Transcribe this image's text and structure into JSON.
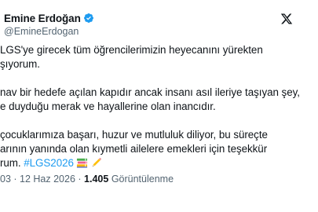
{
  "author": {
    "display_name": "Emine Erdoğan",
    "handle": "@EmineErdogan",
    "verified_color": "#1d9bf0"
  },
  "post": {
    "paragraphs": [
      [
        "LGS'ye girecek tüm öğrencilerimizin heyecanını yürekten",
        "şıyorum."
      ],
      [
        "nav bir hedefe açılan kapıdır ancak insanı asıl ileriye taşıyan şey,",
        "e duyduğu merak ve hayallerine olan inancıdır."
      ],
      [
        "çocuklarımıza başarı, huzur ve mutluluk diliyor, bu süreçte",
        "arının yanında olan kıymetli ailelere emekleri için teşekkür"
      ]
    ],
    "last_line_prefix": "rum.",
    "hashtag": "#LGS2026",
    "emojis": [
      "books-icon",
      "pencil-icon"
    ],
    "hashtag_color": "#1d9bf0"
  },
  "meta": {
    "time": "03 · 12 Haz 2026",
    "separator": "·",
    "views_count": "1.405",
    "views_label": "Görüntülenme"
  },
  "icons": {
    "verified": "verified-badge-icon",
    "platform": "x-logo-icon"
  }
}
